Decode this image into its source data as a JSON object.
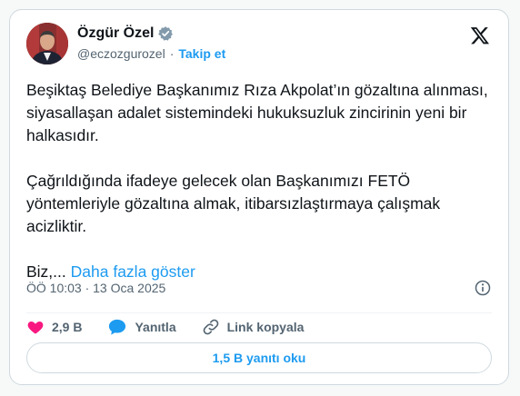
{
  "author": {
    "name": "Özgür Özel",
    "handle": "@eczozgurozel",
    "separator": "·",
    "follow_label": "Takip et"
  },
  "tweet": {
    "paragraphs": [
      "Beşiktaş Belediye Başkanımız Rıza Akpolat’ın gözaltına alınması, siyasallaşan adalet sistemindeki hukuksuzluk zincirinin yeni bir halkasıdır.",
      "Çağrıldığında ifadeye gelecek olan Başkanımızı FETÖ yöntemleriyle gözaltına almak, itibarsızlaştırmaya çalışmak acizliktir."
    ],
    "truncated_text": "Biz,...",
    "show_more_label": "Daha fazla göster",
    "timestamp": "ÖÖ 10:03 · 13 Oca 2025"
  },
  "actions": {
    "like_count": "2,9 B",
    "reply_label": "Yanıtla",
    "copy_link_label": "Link kopyala"
  },
  "read_replies_label": "1,5 B yanıtı oku",
  "colors": {
    "accent": "#1d9bf0",
    "like": "#f91880",
    "muted": "#536471",
    "border": "#cfd9de"
  },
  "icons": {
    "verified": "verified-badge-icon",
    "platform": "x-logo-icon",
    "info": "info-icon",
    "like": "heart-icon",
    "reply": "speech-bubble-icon",
    "link": "link-icon"
  }
}
